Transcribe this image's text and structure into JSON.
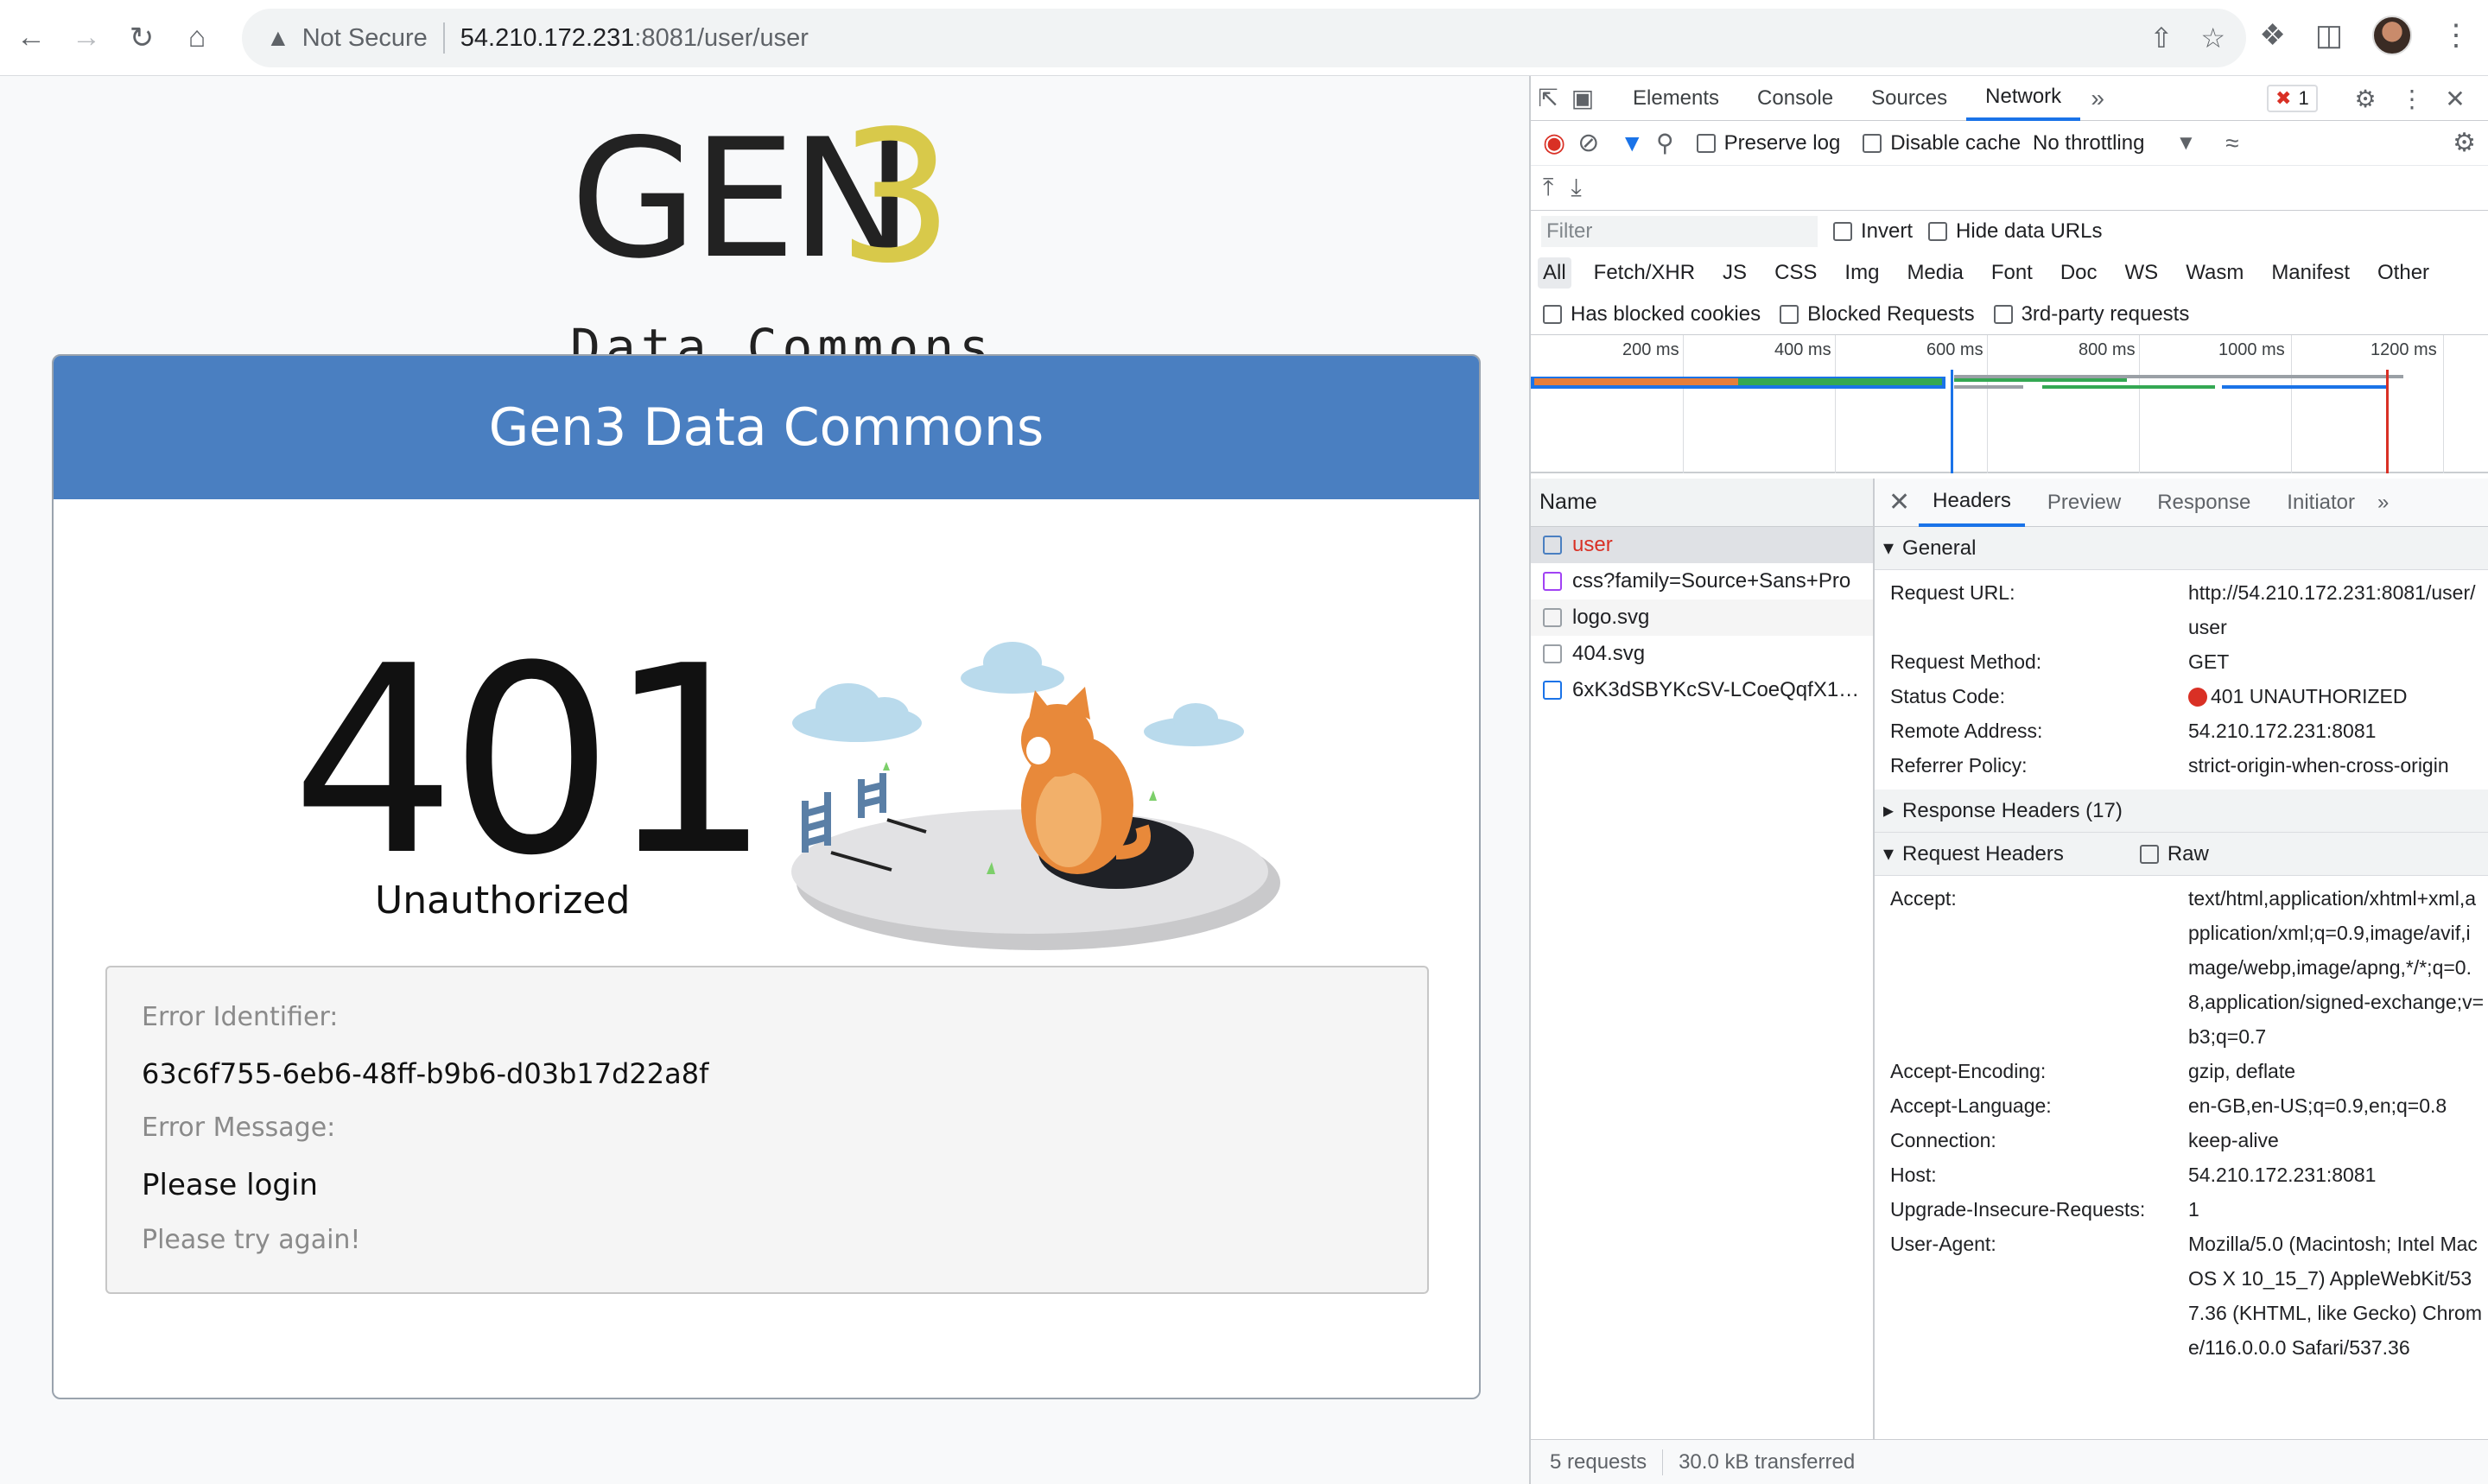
{
  "browser": {
    "security_label": "Not Secure",
    "url_host": "54.210.172.231",
    "url_rest": ":8081/user/user"
  },
  "page": {
    "logo_gen": "GEN",
    "logo_3": "3",
    "logo_sub": "Data Commons",
    "card_title": "Gen3 Data Commons",
    "code": "401",
    "status_text": "Unauthorized",
    "error_identifier_label": "Error Identifier:",
    "error_identifier": "63c6f755-6eb6-48ff-b9b6-d03b17d22a8f",
    "error_message_label": "Error Message:",
    "error_message": "Please login",
    "retry_text": "Please try again!"
  },
  "devtools": {
    "tabs": [
      "Elements",
      "Console",
      "Sources",
      "Network"
    ],
    "active_tab": "Network",
    "error_count": "1",
    "preserve_log": "Preserve log",
    "disable_cache": "Disable cache",
    "throttling": "No throttling",
    "filter_placeholder": "Filter",
    "invert": "Invert",
    "hide_data_urls": "Hide data URLs",
    "types": [
      "All",
      "Fetch/XHR",
      "JS",
      "CSS",
      "Img",
      "Media",
      "Font",
      "Doc",
      "WS",
      "Wasm",
      "Manifest",
      "Other"
    ],
    "has_blocked_cookies": "Has blocked cookies",
    "blocked_requests": "Blocked Requests",
    "third_party": "3rd-party requests",
    "timeline_ticks": [
      "200 ms",
      "400 ms",
      "600 ms",
      "800 ms",
      "1000 ms",
      "1200 ms"
    ],
    "name_column": "Name",
    "requests": [
      {
        "name": "user",
        "icon": "document-icon"
      },
      {
        "name": "css?family=Source+Sans+Pro",
        "icon": "stylesheet-icon"
      },
      {
        "name": "logo.svg",
        "icon": "image-icon"
      },
      {
        "name": "404.svg",
        "icon": "image-icon"
      },
      {
        "name": "6xK3dSBYKcSV-LCoeQqfX1…",
        "icon": "font-icon"
      }
    ],
    "footer_requests": "5 requests",
    "footer_transferred": "30.0 kB transferred",
    "detail_tabs": [
      "Headers",
      "Preview",
      "Response",
      "Initiator"
    ],
    "general_label": "General",
    "general": [
      {
        "k": "Request URL:",
        "v": "http://54.210.172.231:8081/user/user"
      },
      {
        "k": "Request Method:",
        "v": "GET"
      },
      {
        "k": "Status Code:",
        "v": "401 UNAUTHORIZED"
      },
      {
        "k": "Remote Address:",
        "v": "54.210.172.231:8081"
      },
      {
        "k": "Referrer Policy:",
        "v": "strict-origin-when-cross-origin"
      }
    ],
    "response_headers_label": "Response Headers (17)",
    "request_headers_label": "Request Headers",
    "raw_label": "Raw",
    "request_headers": [
      {
        "k": "Accept:",
        "v": "text/html,application/xhtml+xml,application/xml;q=0.9,image/avif,image/webp,image/apng,*/*;q=0.8,application/signed-exchange;v=b3;q=0.7"
      },
      {
        "k": "Accept-Encoding:",
        "v": "gzip, deflate"
      },
      {
        "k": "Accept-Language:",
        "v": "en-GB,en-US;q=0.9,en;q=0.8"
      },
      {
        "k": "Connection:",
        "v": "keep-alive"
      },
      {
        "k": "Host:",
        "v": "54.210.172.231:8081"
      },
      {
        "k": "Upgrade-Insecure-Requests:",
        "v": "1"
      },
      {
        "k": "User-Agent:",
        "v": "Mozilla/5.0 (Macintosh; Intel Mac OS X 10_15_7) AppleWebKit/537.36 (KHTML, like Gecko) Chrome/116.0.0.0 Safari/537.36"
      }
    ]
  }
}
